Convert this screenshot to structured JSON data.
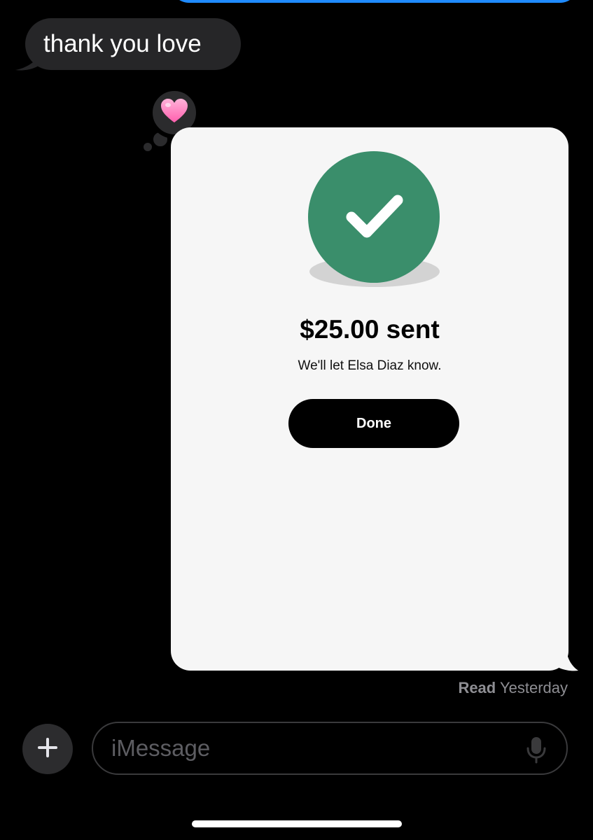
{
  "colors": {
    "background": "#000000",
    "incoming_bubble": "#262628",
    "outgoing_bubble": "#1f8bff",
    "card": "#f6f6f6",
    "success_green": "#3a8e6b",
    "button": "#000000",
    "muted_text": "#8e8e93"
  },
  "conversation": {
    "incoming_message": "thank you love",
    "reaction": "heart-icon"
  },
  "payment_card": {
    "icon": "check-icon",
    "amount_text": "$25.00 sent",
    "subtitle": "We'll let Elsa Diaz know.",
    "done_label": "Done"
  },
  "receipt": {
    "status": "Read",
    "time": "Yesterday"
  },
  "composer": {
    "plus_icon": "plus-icon",
    "placeholder": "iMessage",
    "mic_icon": "microphone-icon"
  }
}
